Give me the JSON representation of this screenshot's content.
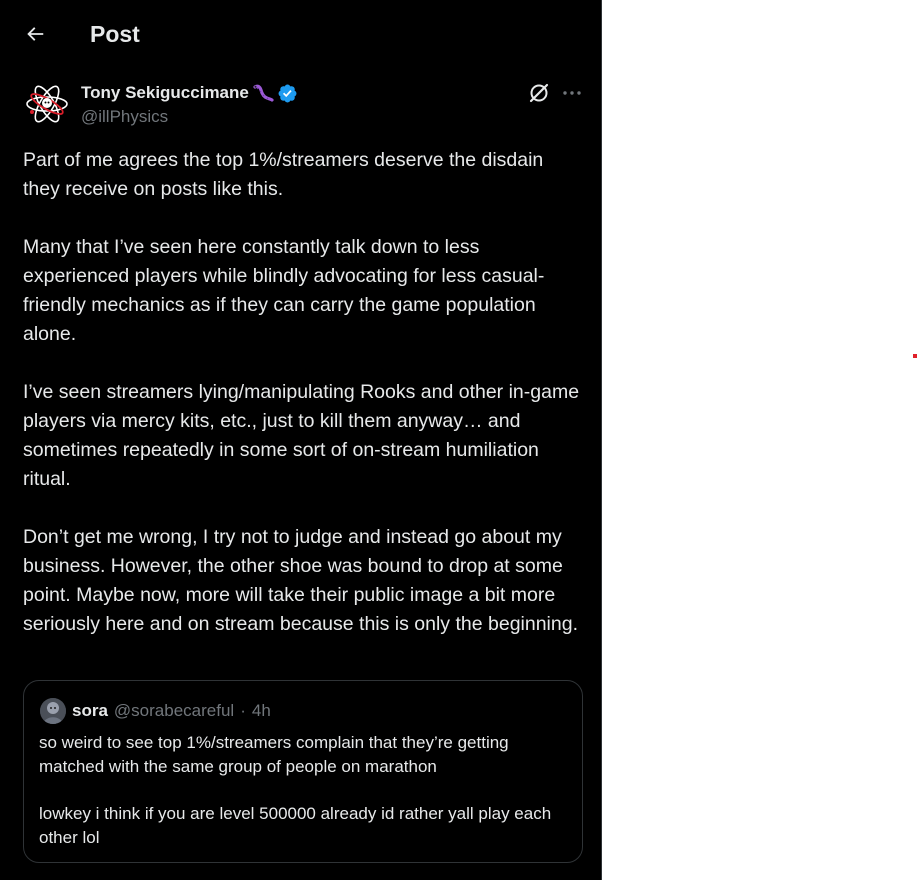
{
  "header": {
    "title": "Post"
  },
  "post": {
    "author_name": "Tony Sekiguccimane",
    "author_handle": "@illPhysics",
    "paragraphs": [
      "Part of me agrees the top 1%/streamers deserve the disdain they receive on posts like this.",
      "Many that I’ve seen here constantly talk down to less experienced players while blindly advocating for less casual-friendly mechanics as if they can carry the game population alone.",
      "I’ve seen streamers lying/manipulating Rooks and other in-game players via mercy kits, etc., just to kill them anyway… and sometimes repeatedly in some sort of on-stream humiliation ritual.",
      "Don’t get me wrong, I try not to judge and instead go about my business. However, the other shoe was bound to drop at some point. Maybe now, more will take their public image a bit more seriously here and on stream because this is only the beginning."
    ]
  },
  "quote": {
    "name": "sora",
    "handle": "@sorabecareful",
    "separator": "·",
    "time": "4h",
    "paragraphs": [
      "so weird to see top 1%/streamers complain that they’re getting matched with the same group of people on marathon",
      "lowkey i think if you are level 500000 already id rather yall play each other lol"
    ]
  },
  "icons": {
    "back": "arrow-left-icon",
    "verified": "verified-badge-icon",
    "name_emoji": "worm-emoji",
    "grok": "grok-icon",
    "more": "more-horizontal-icon"
  },
  "colors": {
    "background": "#000000",
    "text": "#e7e9ea",
    "secondary": "#71767b",
    "verified": "#1d9bf0",
    "border": "#2f3336"
  }
}
